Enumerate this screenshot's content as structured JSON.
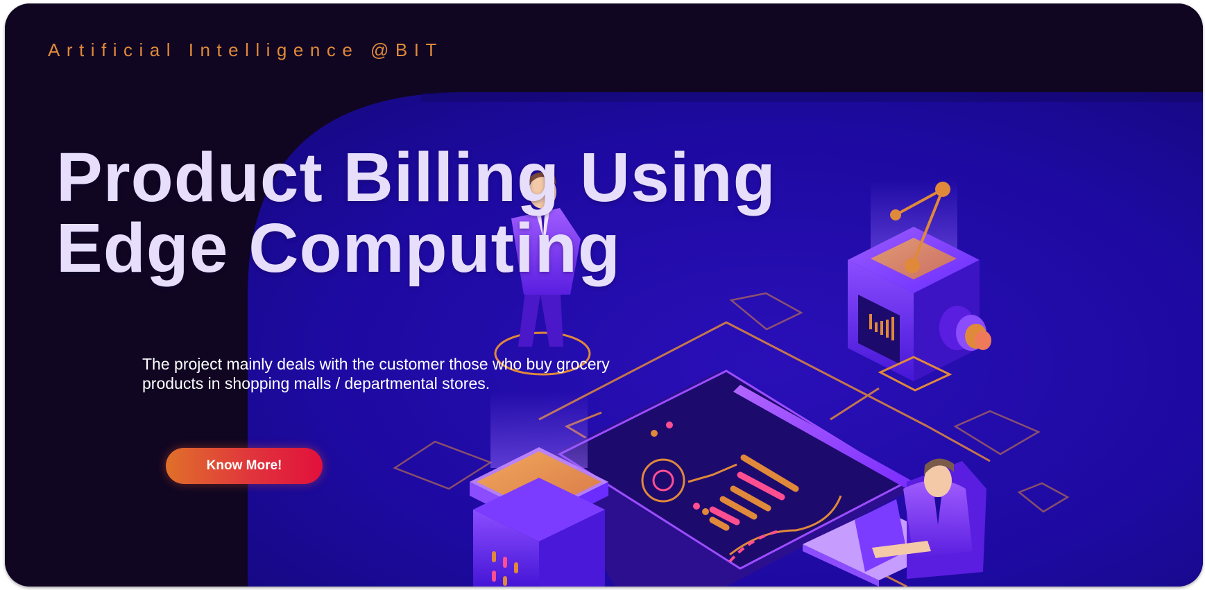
{
  "brand": {
    "text": "Artificial Intelligence @BIT"
  },
  "hero": {
    "title_line1": "Product Billing Using",
    "title_line2": "Edge Computing",
    "description": "The project mainly deals with the customer those who buy grocery products in shopping malls / departmental stores.",
    "cta_label": "Know More!"
  },
  "illustration": {
    "icon": "isometric-edge-computing-illustration"
  },
  "colors": {
    "background": "#100622",
    "panel": "#1c0a9a",
    "brand_text": "#e0893a",
    "title_text": "#e6defa",
    "cta_start": "#e0702a",
    "cta_end": "#e2103c"
  }
}
